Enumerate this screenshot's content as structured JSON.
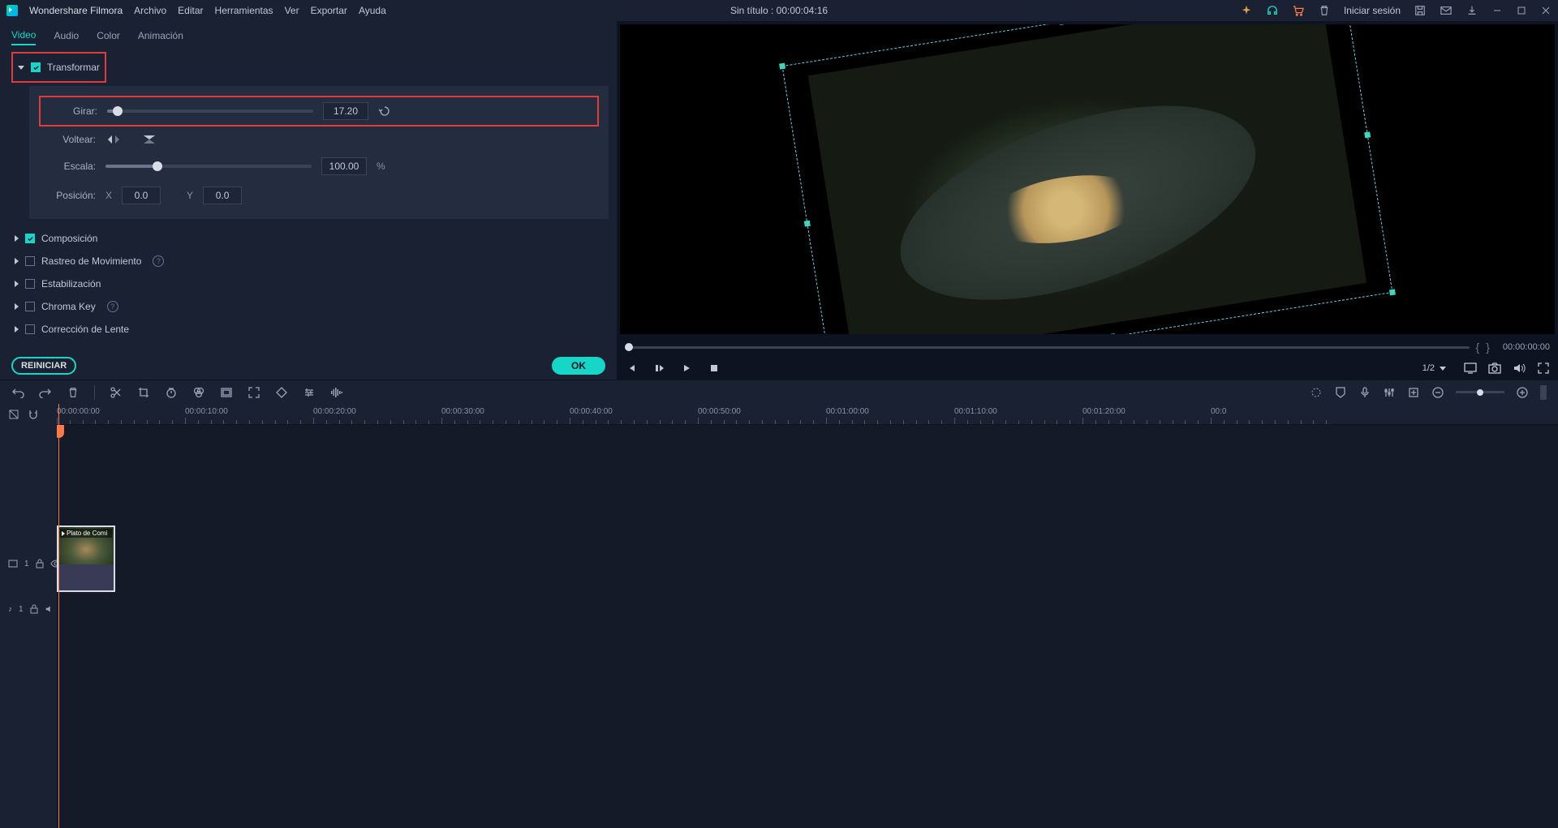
{
  "app_name": "Wondershare Filmora",
  "menu": {
    "file": "Archivo",
    "edit": "Editar",
    "tools": "Herramientas",
    "view": "Ver",
    "export": "Exportar",
    "help": "Ayuda"
  },
  "project_title": "Sin título : 00:00:04:16",
  "login": "Iniciar sesión",
  "tabs": {
    "video": "Video",
    "audio": "Audio",
    "color": "Color",
    "animation": "Animación"
  },
  "transform": {
    "label": "Transformar",
    "rotate": {
      "label": "Girar:",
      "value": "17.20"
    },
    "flip": {
      "label": "Voltear:"
    },
    "scale": {
      "label": "Escala:",
      "value": "100.00",
      "unit": "%"
    },
    "position": {
      "label": "Posición:",
      "x_label": "X",
      "x_value": "0.0",
      "y_label": "Y",
      "y_value": "0.0"
    }
  },
  "sections": {
    "composition": "Composición",
    "motion_tracking": "Rastreo de Movimiento",
    "stabilization": "Estabilización",
    "chroma": "Chroma Key",
    "lens": "Corrección de Lente"
  },
  "reset_btn": "REINICIAR",
  "ok_btn": "OK",
  "playback": {
    "tc_right": "00:00:00:00",
    "ratio": "1/2"
  },
  "ruler": [
    "00:00:00:00",
    "00:00:10:00",
    "00:00:20:00",
    "00:00:30:00",
    "00:00:40:00",
    "00:00:50:00",
    "00:01:00:00",
    "00:01:10:00",
    "00:01:20:00",
    "00:0"
  ],
  "clip_name": "Plato de Comi",
  "track_video_label": "1",
  "track_audio_label": "1"
}
